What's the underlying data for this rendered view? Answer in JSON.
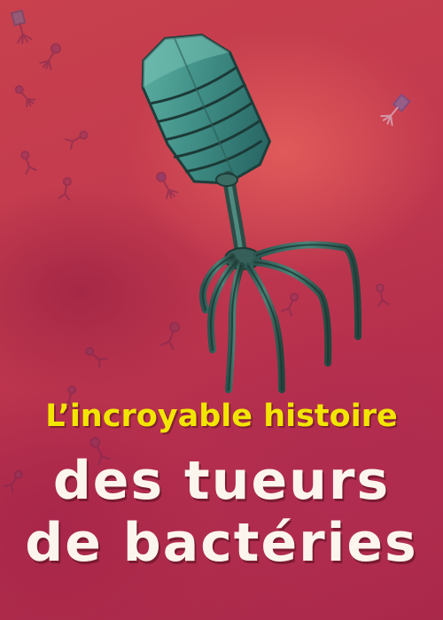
{
  "poster": {
    "subtitle": "L’incroyable histoire",
    "title_line1": "des tueurs",
    "title_line2": "de bactéries"
  },
  "colors": {
    "background": "#c23a4e",
    "subtitle": "#f2e600",
    "title": "#fbf5ee",
    "phage": "#3f8a80"
  },
  "icons": [
    "bacteriophage-illustration",
    "small-phage-icon"
  ]
}
